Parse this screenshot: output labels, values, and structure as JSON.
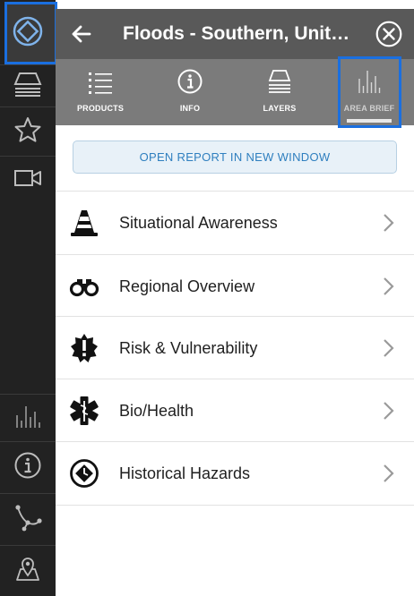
{
  "header": {
    "title": "Floods - Southern, Unit…",
    "back_icon": "arrow-left-icon",
    "close_icon": "close-circle-icon"
  },
  "rail": {
    "items": [
      "diamond-logo-icon",
      "layers-icon",
      "star-icon",
      "video-camera-icon",
      "bar-chart-icon",
      "info-icon",
      "route-icon",
      "map-pin-icon"
    ]
  },
  "tabs": [
    {
      "label": "PRODUCTS",
      "icon": "list-icon"
    },
    {
      "label": "INFO",
      "icon": "info-icon"
    },
    {
      "label": "LAYERS",
      "icon": "layers-icon"
    },
    {
      "label": "AREA BRIEF",
      "icon": "bar-chart-icon",
      "active": true
    }
  ],
  "report_button": {
    "label": "OPEN REPORT IN NEW WINDOW"
  },
  "sections": [
    {
      "label": "Situational Awareness",
      "icon": "traffic-cone-icon"
    },
    {
      "label": "Regional Overview",
      "icon": "binoculars-icon"
    },
    {
      "label": "Risk & Vulnerability",
      "icon": "alert-badge-icon"
    },
    {
      "label": "Bio/Health",
      "icon": "medical-star-icon"
    },
    {
      "label": "Historical Hazards",
      "icon": "hazard-clock-icon"
    }
  ],
  "colors": {
    "rail": "#222222",
    "header": "#595959",
    "tabs": "#7b7b7b",
    "highlight": "#1a6fe0",
    "link": "#2f7fbf"
  }
}
